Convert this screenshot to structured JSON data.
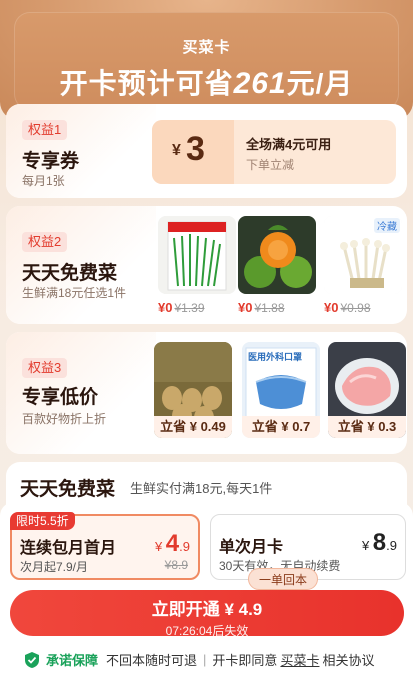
{
  "header": {
    "brand": "买菜卡",
    "headline_prefix": "开卡预计可省",
    "headline_amount": "261",
    "headline_suffix": "元/月"
  },
  "benefit1": {
    "tag": "权益1",
    "title": "专享券",
    "subtitle": "每月1张",
    "coupon": {
      "currency": "¥",
      "amount": "3",
      "condition": "全场满4元可用",
      "hint": "下单立减"
    }
  },
  "benefit2": {
    "tag": "权益2",
    "title": "天天免费菜",
    "subtitle": "生鲜满18元任选1件",
    "products": [
      {
        "name": "韭菜籽",
        "new_price": "¥0",
        "old_price": "¥1.39"
      },
      {
        "name": "砂糖橘",
        "new_price": "¥0",
        "old_price": "¥1.88"
      },
      {
        "name": "金针菇",
        "new_price": "¥0",
        "old_price": "¥0.98",
        "badge": "冷藏"
      }
    ]
  },
  "benefit3": {
    "tag": "权益3",
    "title": "专享低价",
    "subtitle": "百款好物折上折",
    "products": [
      {
        "name": "鸡蛋",
        "save": "立省 ¥ 0.49"
      },
      {
        "name": "医用外科口罩",
        "save": "立省 ¥ 0.7",
        "label": "医用外科口罩"
      },
      {
        "name": "猪肉",
        "save": "立省 ¥ 0.3"
      }
    ]
  },
  "daily": {
    "title": "天天免费菜",
    "subtitle": "生鲜实付满18元,每天1件"
  },
  "plans": [
    {
      "badge": "限时5.5折",
      "name": "连续包月首月",
      "desc": "次月起7.9/月",
      "price_cur": "¥",
      "price_int": "4",
      "price_dec": ".9",
      "orig": "¥8.9"
    },
    {
      "name": "单次月卡",
      "desc": "30天有效，无自动续费",
      "price_cur": "¥",
      "price_int": "8",
      "price_dec": ".9"
    }
  ],
  "cta": {
    "bubble": "一单回本",
    "label": "立即开通 ¥ 4.9",
    "timer": "07:26:04后失效"
  },
  "footer": {
    "promise": "承诺保障",
    "item1": "不回本随时可退",
    "agree_prefix": "开卡即同意",
    "link": "买菜卡",
    "agree_suffix": "相关协议"
  }
}
